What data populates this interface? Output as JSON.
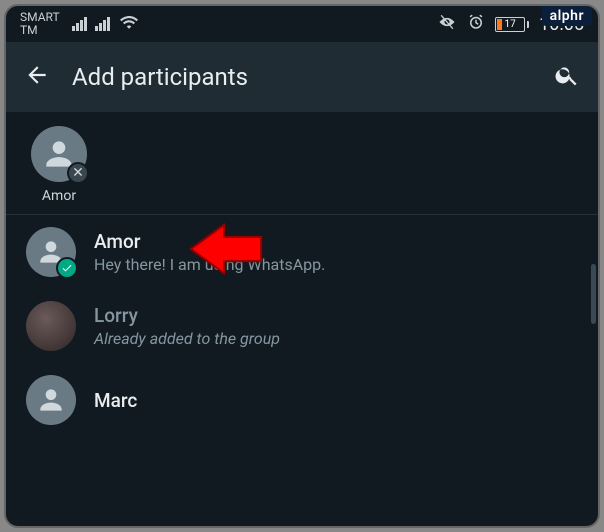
{
  "brand": "alphr",
  "status": {
    "carrier_line1": "SMART",
    "carrier_line2": "TM",
    "battery_percent": "17",
    "time": "10:05"
  },
  "appbar": {
    "title": "Add participants"
  },
  "selected": {
    "name": "Amor"
  },
  "contacts": [
    {
      "name": "Amor",
      "sub": "Hey there! I am using WhatsApp.",
      "selected": true,
      "disabled": false,
      "photo": false
    },
    {
      "name": "Lorry",
      "sub": "Already added to the group",
      "selected": false,
      "disabled": true,
      "photo": true
    },
    {
      "name": "Marc",
      "sub": "",
      "selected": false,
      "disabled": false,
      "photo": false
    }
  ]
}
